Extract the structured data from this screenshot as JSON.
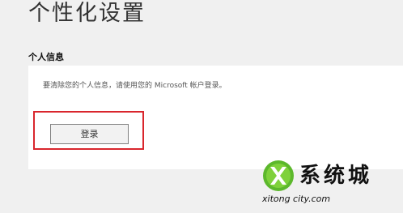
{
  "page": {
    "title": "个性化设置"
  },
  "personal_info": {
    "heading": "个人信息",
    "description": "要清除您的个人信息，请使用您的 Microsoft 帐户登录。",
    "login_label": "登录"
  },
  "colors": {
    "highlight": "#d9262d",
    "background": "#f0f0f0",
    "card": "#ffffff"
  },
  "watermark": {
    "icon": "green-x-logo",
    "brand_cn": "系统城",
    "brand_url": "xitong city.com"
  }
}
